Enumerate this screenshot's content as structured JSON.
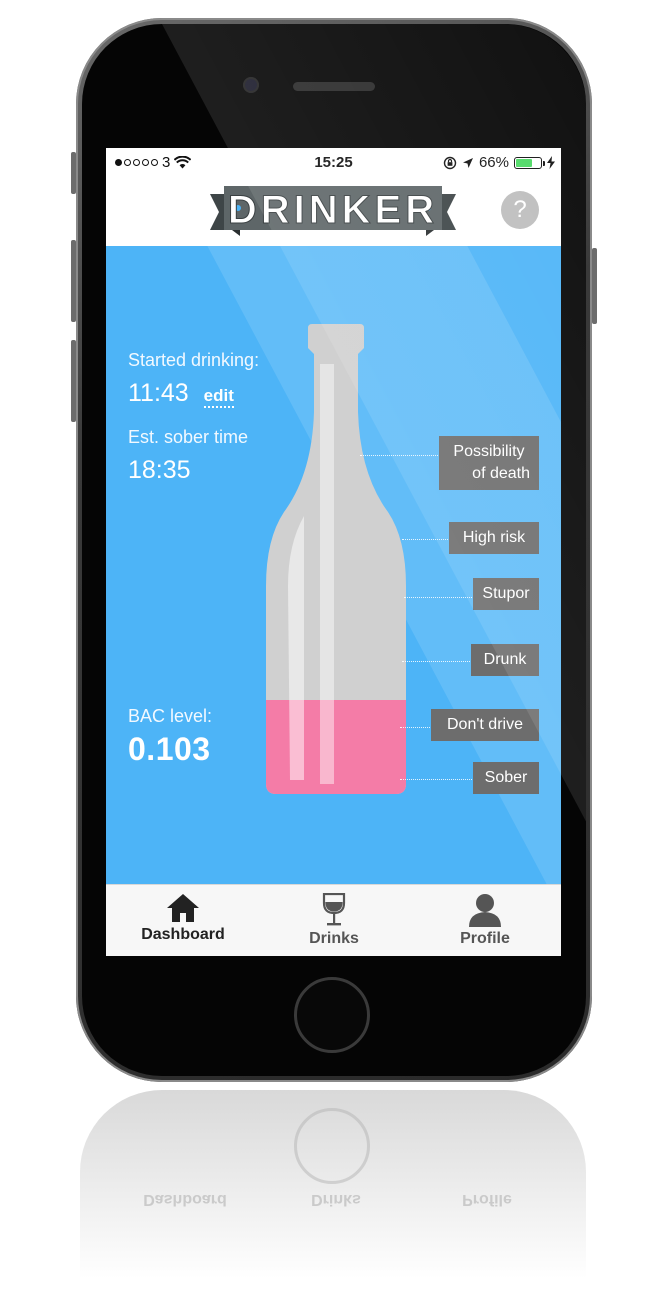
{
  "status_bar": {
    "carrier": "3",
    "time": "15:25",
    "battery_percent": "66%",
    "battery_level": 0.66,
    "signal_bars_filled": 1,
    "signal_bars_total": 5
  },
  "header": {
    "app_title": "DRINKER",
    "help_label": "?"
  },
  "dashboard": {
    "started_label": "Started drinking:",
    "started_time": "11:43",
    "edit_label": "edit",
    "sober_label": "Est. sober time",
    "sober_time": "18:35",
    "bac_label": "BAC level:",
    "bac_value": "0.103",
    "bottle_fill_level": 0.2
  },
  "levels": [
    {
      "label": "Possibility of death",
      "line1": "Possibility",
      "line2": "of death"
    },
    {
      "label": "High risk"
    },
    {
      "label": "Stupor"
    },
    {
      "label": "Drunk"
    },
    {
      "label": "Don't drive"
    },
    {
      "label": "Sober"
    }
  ],
  "tabs": [
    {
      "label": "Dashboard",
      "icon": "home-icon",
      "active": true
    },
    {
      "label": "Drinks",
      "icon": "wine-glass-icon",
      "active": false
    },
    {
      "label": "Profile",
      "icon": "person-icon",
      "active": false
    }
  ],
  "colors": {
    "background_blue": "#4db4f7",
    "bottle_gray": "#d0d0d0",
    "liquid_pink": "#f47ca7",
    "tag_gray": "#6d6d6d",
    "banner_gray": "#5e6668",
    "banner_dot_blue": "#4db4f7"
  }
}
